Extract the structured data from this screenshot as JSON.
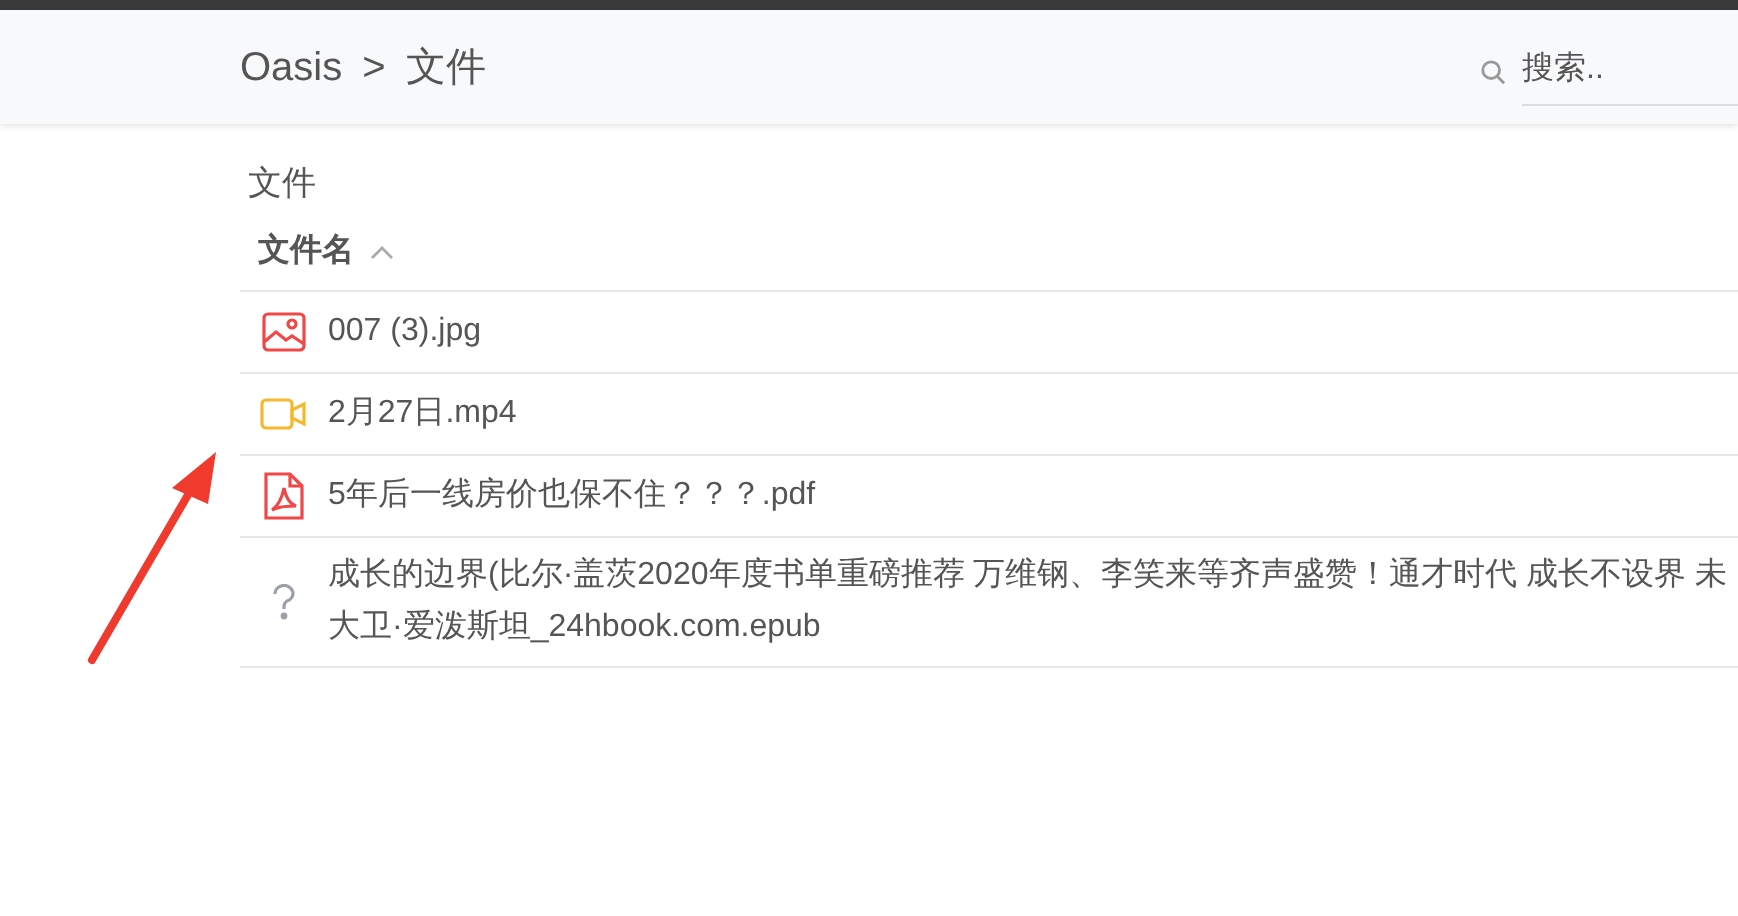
{
  "breadcrumb": {
    "root": "Oasis",
    "separator": ">",
    "current": "文件"
  },
  "search": {
    "placeholder": "搜索.."
  },
  "section_title": "文件",
  "table": {
    "column": {
      "label": "文件名",
      "sort_ascending": true
    },
    "rows": [
      {
        "kind": "image",
        "lines": [
          "007 (3).jpg"
        ]
      },
      {
        "kind": "video",
        "lines": [
          "2月27日.mp4"
        ]
      },
      {
        "kind": "pdf",
        "lines": [
          "5年后一线房价也保不住？？？.pdf"
        ]
      },
      {
        "kind": "unknown",
        "lines": [
          "成长的边界(比尔·盖茨2020年度书单重磅推荐 万维钢、李笑来等齐声盛赞！通才时代 成长不设界 未",
          "大卫·爱泼斯坦_24hbook.com.epub"
        ]
      }
    ]
  }
}
